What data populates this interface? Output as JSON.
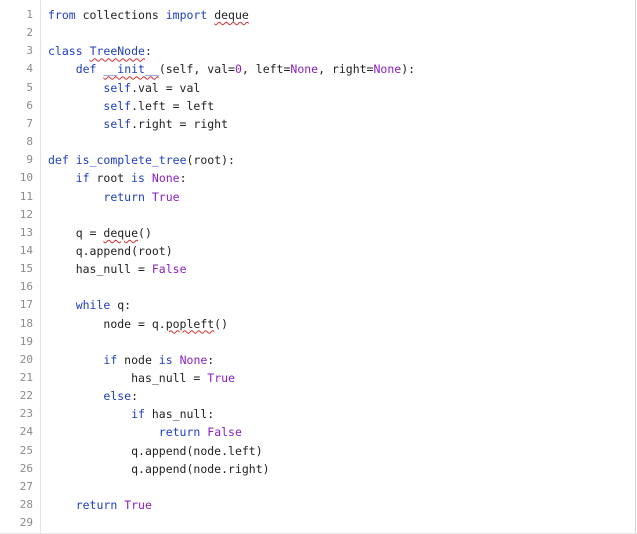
{
  "editor": {
    "lines": [
      {
        "n": "1",
        "indent": "",
        "tokens": [
          {
            "t": "from",
            "c": "kw"
          },
          {
            "t": " collections ",
            "c": "plain"
          },
          {
            "t": "import",
            "c": "kw"
          },
          {
            "t": " ",
            "c": "plain"
          },
          {
            "t": "deque",
            "c": "plain",
            "squig": true
          }
        ]
      },
      {
        "n": "2",
        "indent": "",
        "tokens": []
      },
      {
        "n": "3",
        "indent": "",
        "tokens": [
          {
            "t": "class",
            "c": "kw"
          },
          {
            "t": " ",
            "c": "plain"
          },
          {
            "t": "TreeNode",
            "c": "kw",
            "squig": true
          },
          {
            "t": ":",
            "c": "plain"
          }
        ]
      },
      {
        "n": "4",
        "indent": "    ",
        "tokens": [
          {
            "t": "def",
            "c": "kw"
          },
          {
            "t": " ",
            "c": "plain"
          },
          {
            "t": "__init__",
            "c": "kw",
            "squig": true
          },
          {
            "t": "(self, val=",
            "c": "plain"
          },
          {
            "t": "0",
            "c": "lit"
          },
          {
            "t": ", left=",
            "c": "plain"
          },
          {
            "t": "None",
            "c": "lit"
          },
          {
            "t": ", right=",
            "c": "plain"
          },
          {
            "t": "None",
            "c": "lit"
          },
          {
            "t": "):",
            "c": "plain"
          }
        ]
      },
      {
        "n": "5",
        "indent": "        ",
        "tokens": [
          {
            "t": "self",
            "c": "kw"
          },
          {
            "t": ".val = val",
            "c": "plain"
          }
        ]
      },
      {
        "n": "6",
        "indent": "        ",
        "tokens": [
          {
            "t": "self",
            "c": "kw"
          },
          {
            "t": ".left = left",
            "c": "plain"
          }
        ]
      },
      {
        "n": "7",
        "indent": "        ",
        "tokens": [
          {
            "t": "self",
            "c": "kw"
          },
          {
            "t": ".right = right",
            "c": "plain"
          }
        ]
      },
      {
        "n": "8",
        "indent": "",
        "tokens": []
      },
      {
        "n": "9",
        "indent": "",
        "tokens": [
          {
            "t": "def",
            "c": "kw"
          },
          {
            "t": " ",
            "c": "plain"
          },
          {
            "t": "is_complete_tree",
            "c": "kw"
          },
          {
            "t": "(root):",
            "c": "plain"
          }
        ]
      },
      {
        "n": "10",
        "indent": "    ",
        "tokens": [
          {
            "t": "if",
            "c": "kw"
          },
          {
            "t": " root ",
            "c": "plain"
          },
          {
            "t": "is",
            "c": "kw"
          },
          {
            "t": " ",
            "c": "plain"
          },
          {
            "t": "None",
            "c": "lit"
          },
          {
            "t": ":",
            "c": "plain"
          }
        ]
      },
      {
        "n": "11",
        "indent": "        ",
        "tokens": [
          {
            "t": "return",
            "c": "kw"
          },
          {
            "t": " ",
            "c": "plain"
          },
          {
            "t": "True",
            "c": "lit"
          }
        ]
      },
      {
        "n": "12",
        "indent": "",
        "tokens": []
      },
      {
        "n": "13",
        "indent": "    ",
        "tokens": [
          {
            "t": "q = ",
            "c": "plain"
          },
          {
            "t": "deque",
            "c": "plain",
            "squig": true
          },
          {
            "t": "()",
            "c": "plain"
          }
        ]
      },
      {
        "n": "14",
        "indent": "    ",
        "tokens": [
          {
            "t": "q.append(root)",
            "c": "plain"
          }
        ]
      },
      {
        "n": "15",
        "indent": "    ",
        "tokens": [
          {
            "t": "has_null = ",
            "c": "plain"
          },
          {
            "t": "False",
            "c": "lit"
          }
        ]
      },
      {
        "n": "16",
        "indent": "",
        "tokens": []
      },
      {
        "n": "17",
        "indent": "    ",
        "tokens": [
          {
            "t": "while",
            "c": "kw"
          },
          {
            "t": " q:",
            "c": "plain"
          }
        ]
      },
      {
        "n": "18",
        "indent": "        ",
        "tokens": [
          {
            "t": "node = q.",
            "c": "plain"
          },
          {
            "t": "popleft",
            "c": "plain",
            "squig": true
          },
          {
            "t": "()",
            "c": "plain"
          }
        ]
      },
      {
        "n": "19",
        "indent": "",
        "tokens": []
      },
      {
        "n": "20",
        "indent": "        ",
        "tokens": [
          {
            "t": "if",
            "c": "kw"
          },
          {
            "t": " node ",
            "c": "plain"
          },
          {
            "t": "is",
            "c": "kw"
          },
          {
            "t": " ",
            "c": "plain"
          },
          {
            "t": "None",
            "c": "lit"
          },
          {
            "t": ":",
            "c": "plain"
          }
        ]
      },
      {
        "n": "21",
        "indent": "            ",
        "tokens": [
          {
            "t": "has_null = ",
            "c": "plain"
          },
          {
            "t": "True",
            "c": "lit"
          }
        ]
      },
      {
        "n": "22",
        "indent": "        ",
        "tokens": [
          {
            "t": "else",
            "c": "kw"
          },
          {
            "t": ":",
            "c": "plain"
          }
        ]
      },
      {
        "n": "23",
        "indent": "            ",
        "tokens": [
          {
            "t": "if",
            "c": "kw"
          },
          {
            "t": " has_null:",
            "c": "plain"
          }
        ]
      },
      {
        "n": "24",
        "indent": "                ",
        "tokens": [
          {
            "t": "return",
            "c": "kw"
          },
          {
            "t": " ",
            "c": "plain"
          },
          {
            "t": "False",
            "c": "lit"
          }
        ]
      },
      {
        "n": "25",
        "indent": "            ",
        "tokens": [
          {
            "t": "q.append(node.left)",
            "c": "plain"
          }
        ]
      },
      {
        "n": "26",
        "indent": "            ",
        "tokens": [
          {
            "t": "q.append(node.right)",
            "c": "plain"
          }
        ]
      },
      {
        "n": "27",
        "indent": "",
        "tokens": []
      },
      {
        "n": "28",
        "indent": "    ",
        "tokens": [
          {
            "t": "return",
            "c": "kw"
          },
          {
            "t": " ",
            "c": "plain"
          },
          {
            "t": "True",
            "c": "lit"
          }
        ]
      },
      {
        "n": "29",
        "indent": "",
        "tokens": []
      }
    ]
  }
}
